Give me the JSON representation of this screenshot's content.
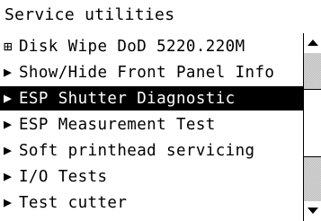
{
  "header": {
    "title": "Service utilities"
  },
  "menu": {
    "items": [
      {
        "icon": "expandable-box-icon",
        "glyph": "⊞",
        "label": "Disk Wipe DoD 5220.220M",
        "selected": false
      },
      {
        "icon": "right-triangle-icon",
        "glyph": "▶",
        "label": "Show/Hide Front Panel Info",
        "selected": false
      },
      {
        "icon": "right-triangle-icon",
        "glyph": "▶",
        "label": "ESP Shutter Diagnostic",
        "selected": true
      },
      {
        "icon": "right-triangle-icon",
        "glyph": "▶",
        "label": "ESP Measurement Test",
        "selected": false
      },
      {
        "icon": "right-triangle-icon",
        "glyph": "▶",
        "label": "Soft printhead servicing",
        "selected": false
      },
      {
        "icon": "right-triangle-icon",
        "glyph": "▶",
        "label": "I/O Tests",
        "selected": false
      },
      {
        "icon": "right-triangle-icon",
        "glyph": "▶",
        "label": "Test cutter",
        "selected": false
      }
    ]
  },
  "scrollbar": {
    "up_icon": "scroll-up-arrow-icon",
    "down_icon": "scroll-down-arrow-icon",
    "thumb_position_fraction": 0.3
  },
  "colors": {
    "background": "#ffffff",
    "text": "#000000",
    "selected_background": "#000000",
    "selected_text": "#ffffff",
    "track": "#d8d8d8"
  }
}
